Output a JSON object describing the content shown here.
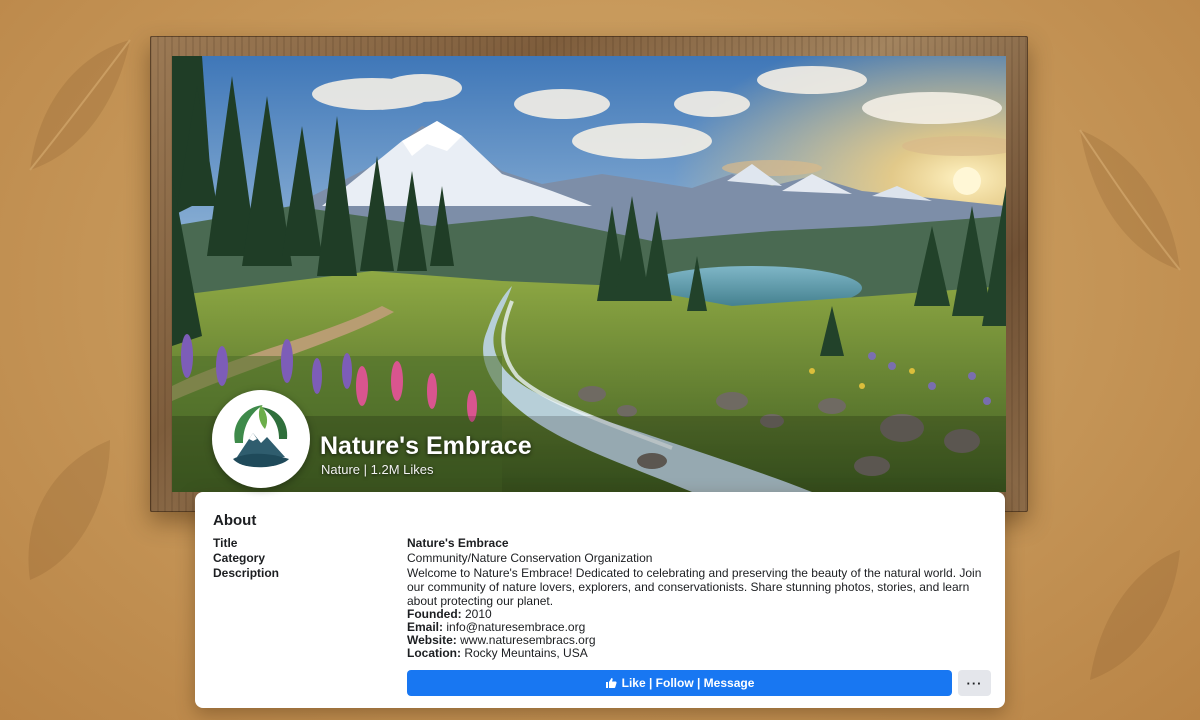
{
  "page": {
    "name": "Nature's Embrace",
    "subtitle": "Nature | 1.2M Likes"
  },
  "about": {
    "heading": "About",
    "title_label": "Title",
    "title_value": "Nature's Embrace",
    "category_label": "Category",
    "category_value": "Community/Nature Conservation Organization",
    "description_label": "Description",
    "description_value": "Welcome to Nature's Embrace! Dedicated to celebrating and preserving the beauty of the natural world. Join our community of nature lovers, explorers, and conservationists. Share stunning photos, stories, and learn about protecting our planet.",
    "founded_label": "Founded:",
    "founded_value": "2010",
    "email_label": "Email:",
    "email_value": "info@naturesembrace.org",
    "website_label": "Website:",
    "website_value": "www.naturesembracs.org",
    "location_label": "Location:",
    "location_value": "Rocky Meuntains, USA"
  },
  "actions": {
    "primary_label": "Like | Follow | Message",
    "primary_icon": "thumbs-up-icon",
    "more_label": "···"
  },
  "colors": {
    "accent": "#1877f2",
    "background": "#c89a5c",
    "frame": "#8a6a47"
  }
}
